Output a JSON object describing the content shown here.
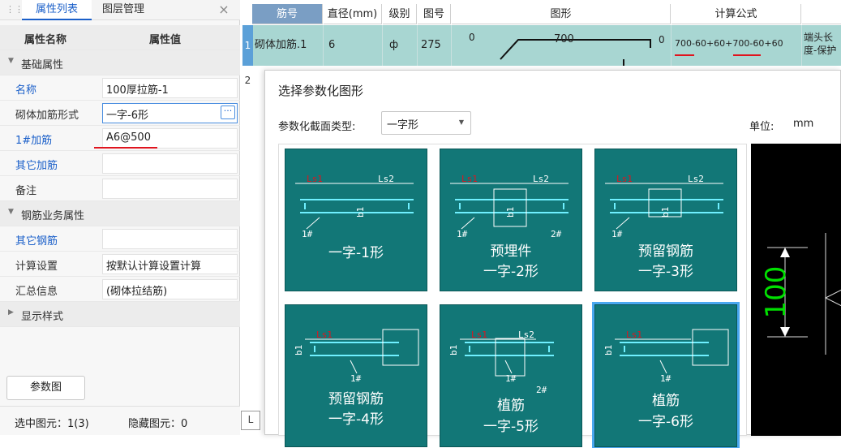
{
  "panel": {
    "tab_active": "属性列表",
    "tab_other": "图层管理",
    "close_glyph": "×",
    "header_name": "属性名称",
    "header_value": "属性值",
    "group_basic": "基础属性",
    "name_label": "名称",
    "name_value": "100厚拉筋-1",
    "form_label": "砌体加筋形式",
    "form_value": "一字-6形",
    "bar1_label": "1#加筋",
    "bar1_value": "A6@500",
    "other_bar_label": "其它加筋",
    "other_bar_value": "",
    "remark_label": "备注",
    "remark_value": "",
    "group_business": "钢筋业务属性",
    "other_steel_label": "其它钢筋",
    "other_steel_value": "",
    "calc_label": "计算设置",
    "calc_value": "按默认计算设置计算",
    "summary_label": "汇总信息",
    "summary_value": "(砌体拉结筋)",
    "group_display": "显示样式",
    "param_button": "参数图",
    "status_selected": "选中图元：1(3)",
    "status_hidden": "隐藏图元：0",
    "mini_glyph": "L"
  },
  "grid": {
    "headers": [
      "筋号",
      "直径(mm)",
      "级别",
      "图号",
      "图形",
      "计算公式"
    ],
    "row1": {
      "num": "1",
      "name": "砌体加筋.1",
      "diameter": "6",
      "grade": "ф",
      "fig": "275",
      "shape_left": "0",
      "shape_mid": "700",
      "shape_right": "0",
      "formula": "700-60+60+700-60+60",
      "end_note": "端头长度-保护"
    },
    "row2": {
      "num": "2"
    }
  },
  "dialog": {
    "title": "选择参数化图形",
    "type_label": "参数化截面类型:",
    "type_value": "一字形",
    "unit_label": "单位:",
    "unit_value": "mm",
    "shapes": [
      {
        "name": "一字-1形",
        "line1": "一字-1形",
        "line2": "",
        "labels": [
          "Ls1",
          "Ls2",
          "b1",
          "1#"
        ]
      },
      {
        "name": "预埋件一字-2形",
        "line1": "预埋件",
        "line2": "一字-2形",
        "labels": [
          "Ls1",
          "Ls2",
          "b1",
          "1#",
          "2#"
        ]
      },
      {
        "name": "预留钢筋一字-3形",
        "line1": "预留钢筋",
        "line2": "一字-3形",
        "labels": [
          "Ls1",
          "Ls2",
          "b1",
          "1#"
        ]
      },
      {
        "name": "预留钢筋一字-4形",
        "line1": "预留钢筋",
        "line2": "一字-4形",
        "labels": [
          "Ls1",
          "b1",
          "1#"
        ]
      },
      {
        "name": "植筋一字-5形",
        "line1": "植筋",
        "line2": "一字-5形",
        "labels": [
          "Ls1",
          "Ls2",
          "b1",
          "1#",
          "2#"
        ]
      },
      {
        "name": "植筋一字-6形",
        "line1": "植筋",
        "line2": "一字-6形",
        "labels": [
          "Ls1",
          "b1",
          "1#"
        ]
      }
    ],
    "selected_shape": 5,
    "preview_dim": "100"
  },
  "colors": {
    "shape_bg": "#127777",
    "shape_line": "#6ff0ff",
    "accent_red": "#e0141e",
    "link_blue": "#1a5fc9",
    "grid_header": "#7a9ec4",
    "grid_row": "#a8d6d2",
    "preview_green": "#00e000"
  }
}
